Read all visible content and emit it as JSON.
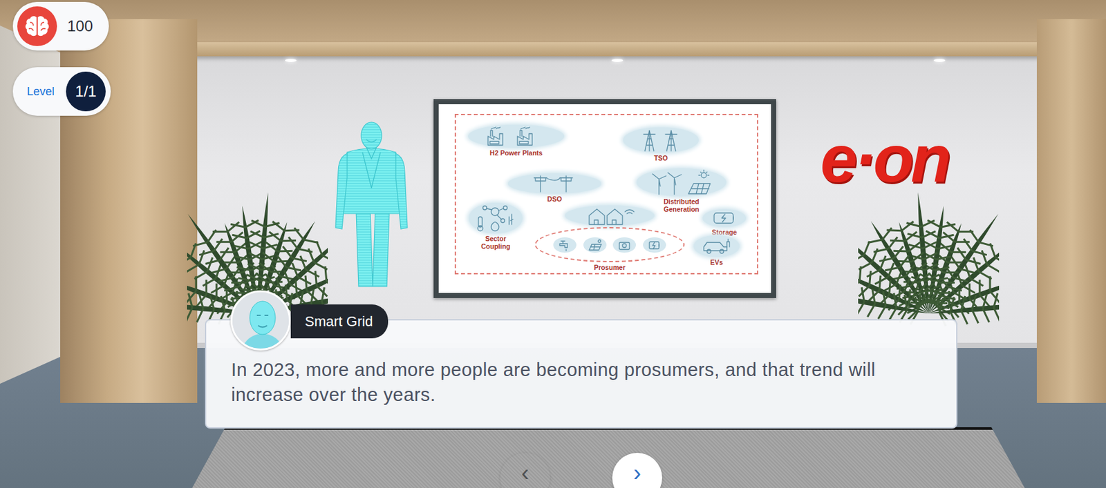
{
  "hud": {
    "score": "100",
    "level_label": "Level",
    "level": "1/1"
  },
  "scene": {
    "logo": "e·on",
    "board": {
      "nodes": [
        {
          "label": "H2 Power Plants",
          "kind": "plant"
        },
        {
          "label": "TSO",
          "kind": "pylon"
        },
        {
          "label": "DSO",
          "kind": "pole"
        },
        {
          "label": "Distributed Generation",
          "kind": "renewable"
        },
        {
          "label": "Sector Coupling",
          "kind": "network"
        },
        {
          "label": "Prosumer",
          "kind": "prosumer"
        },
        {
          "label": "Storage",
          "kind": "battery"
        },
        {
          "label": "EVs",
          "kind": "car"
        }
      ]
    }
  },
  "dialog": {
    "speaker": "Smart Grid",
    "text": "In 2023, more and more people are becoming prosumers, and that trend will increase over the years."
  },
  "navigation": [
    {
      "label": "‹",
      "disabled": true
    },
    {
      "label": "›",
      "disabled": false
    }
  ]
}
